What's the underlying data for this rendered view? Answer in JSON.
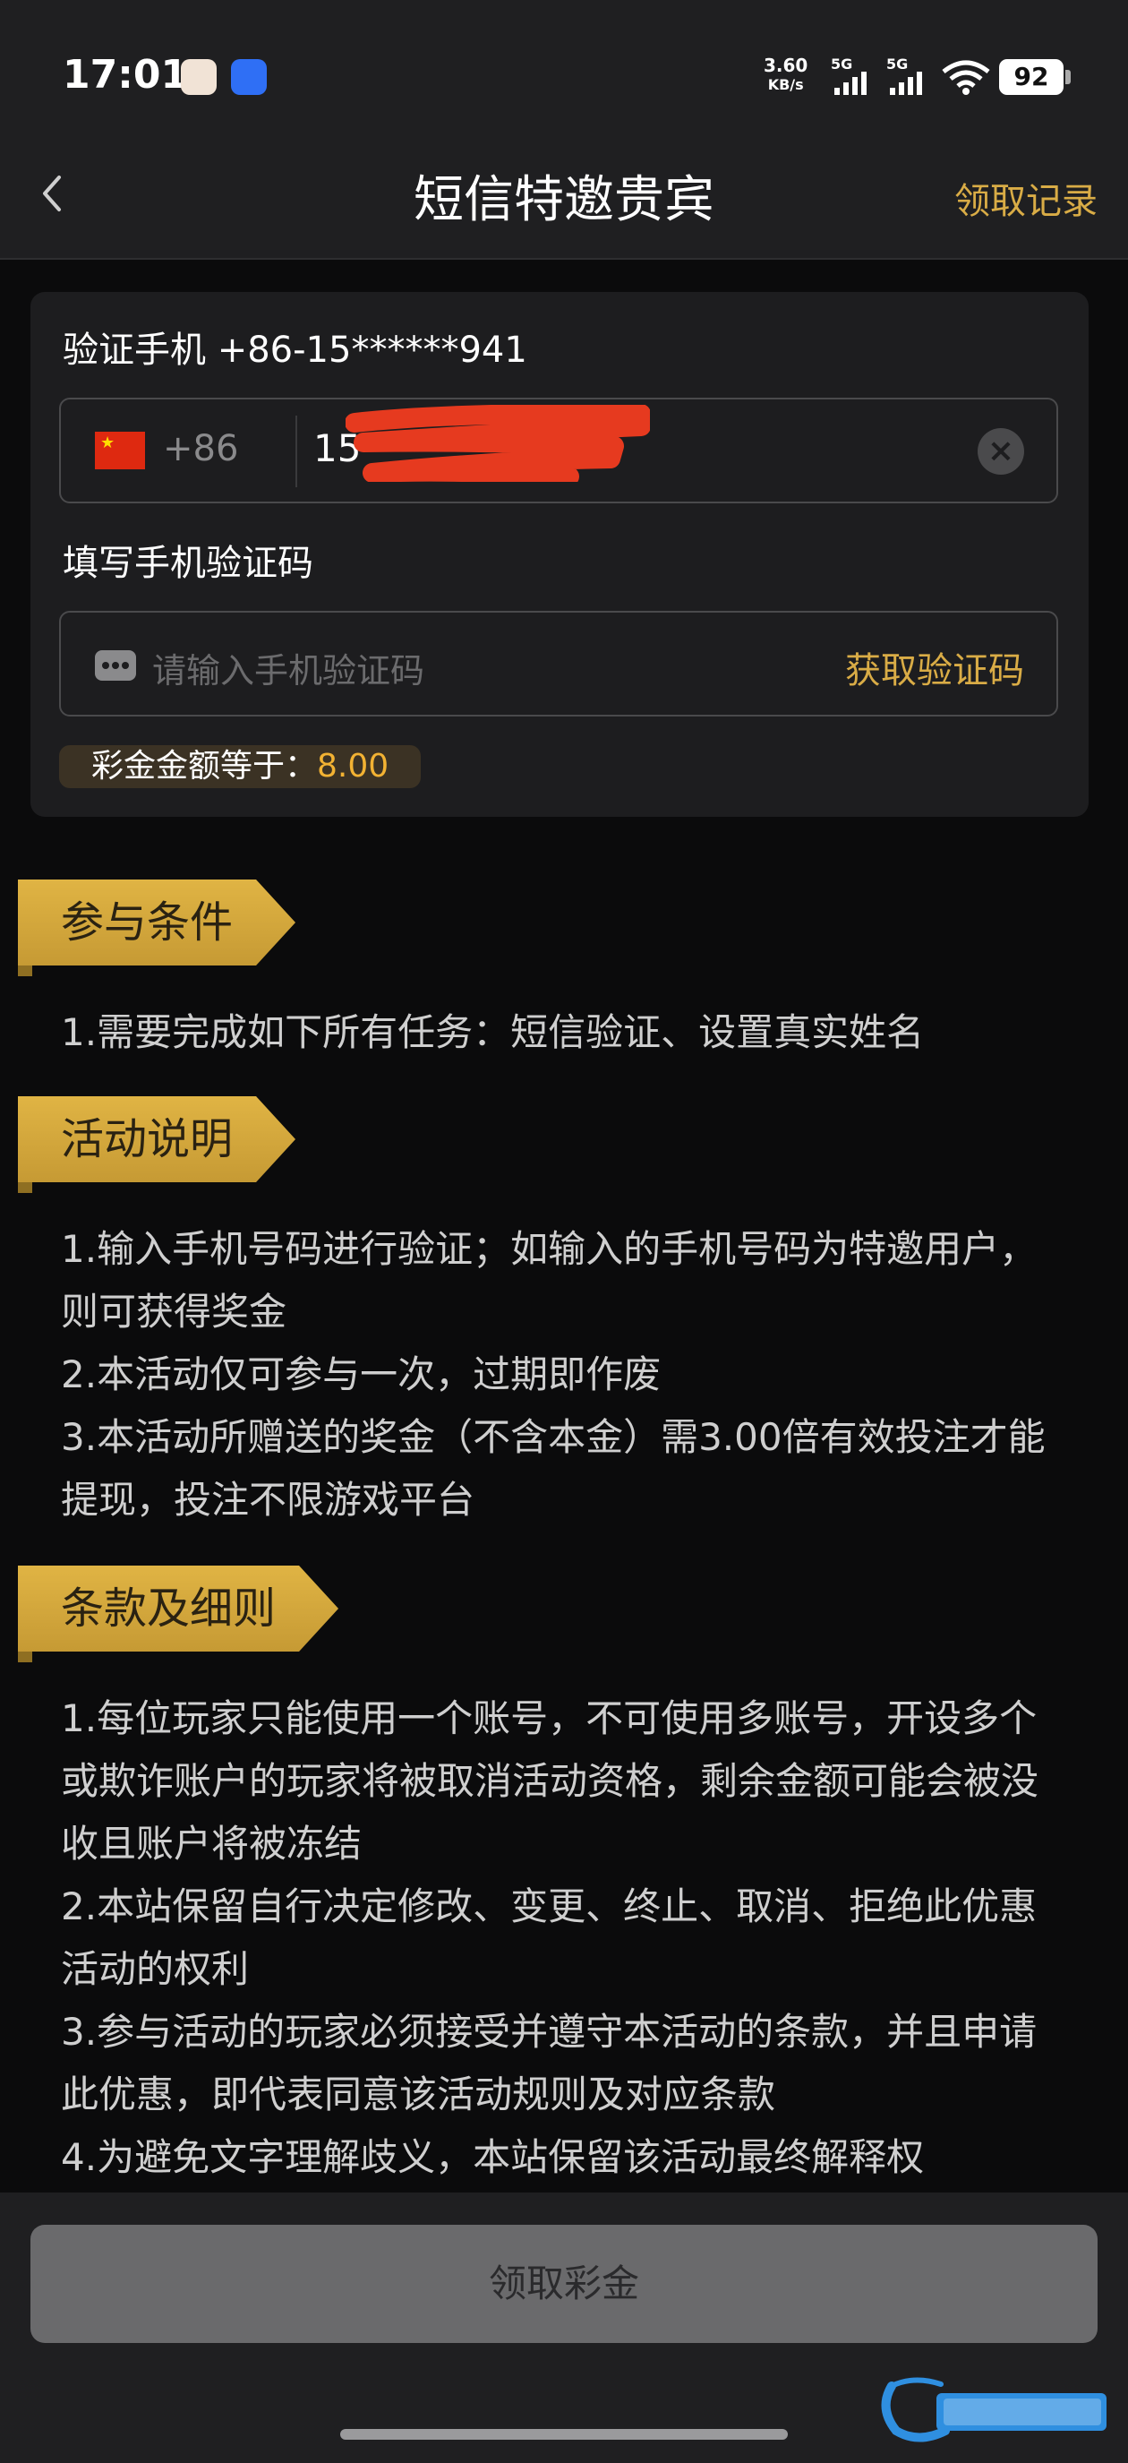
{
  "status_bar": {
    "time": "17:01",
    "net_speed_value": "3.60",
    "net_speed_unit": "KB/s",
    "signal_1": "5G",
    "signal_2": "5G",
    "battery": "92"
  },
  "header": {
    "title": "短信特邀贵宾",
    "records_link": "领取记录",
    "back_icon": "chevron-left-icon"
  },
  "form": {
    "verify_phone_label": "验证手机 +86-15******941",
    "country_code": "+86",
    "phone_value": "15",
    "code_label": "填写手机验证码",
    "code_placeholder": "请输入手机验证码",
    "get_code_button": "获取验证码",
    "amount_label": "彩金金额等于：",
    "amount_value": "8.00"
  },
  "sections": [
    {
      "title": "参与条件",
      "lines": [
        "1.需要完成如下所有任务：短信验证、设置真实姓名"
      ]
    },
    {
      "title": "活动说明",
      "lines": [
        "1.输入手机号码进行验证；如输入的手机号码为特邀用户，则可获得奖金",
        "2.本活动仅可参与一次，过期即作废",
        "3.本活动所赠送的奖金（不含本金）需3.00倍有效投注才能提现，投注不限游戏平台"
      ]
    },
    {
      "title": "条款及细则",
      "lines": [
        "1.每位玩家只能使用一个账号，不可使用多账号，开设多个或欺诈账户的玩家将被取消活动资格，剩余金额可能会被没收且账户将被冻结",
        "2.本站保留自行决定修改、变更、终止、取消、拒绝此优惠活动的权利",
        "3.参与活动的玩家必须接受并遵守本活动的条款，并且申请此优惠，即代表同意该活动规则及对应条款",
        "4.为避免文字理解歧义，本站保留该活动最终解释权"
      ]
    }
  ],
  "footer": {
    "claim_button": "领取彩金"
  },
  "colors": {
    "accent_gold": "#d9ac46",
    "amount_orange": "#f2b233",
    "background": "#0b0b0c",
    "card": "#1d1d1f",
    "button_disabled": "#6a6a6c"
  }
}
